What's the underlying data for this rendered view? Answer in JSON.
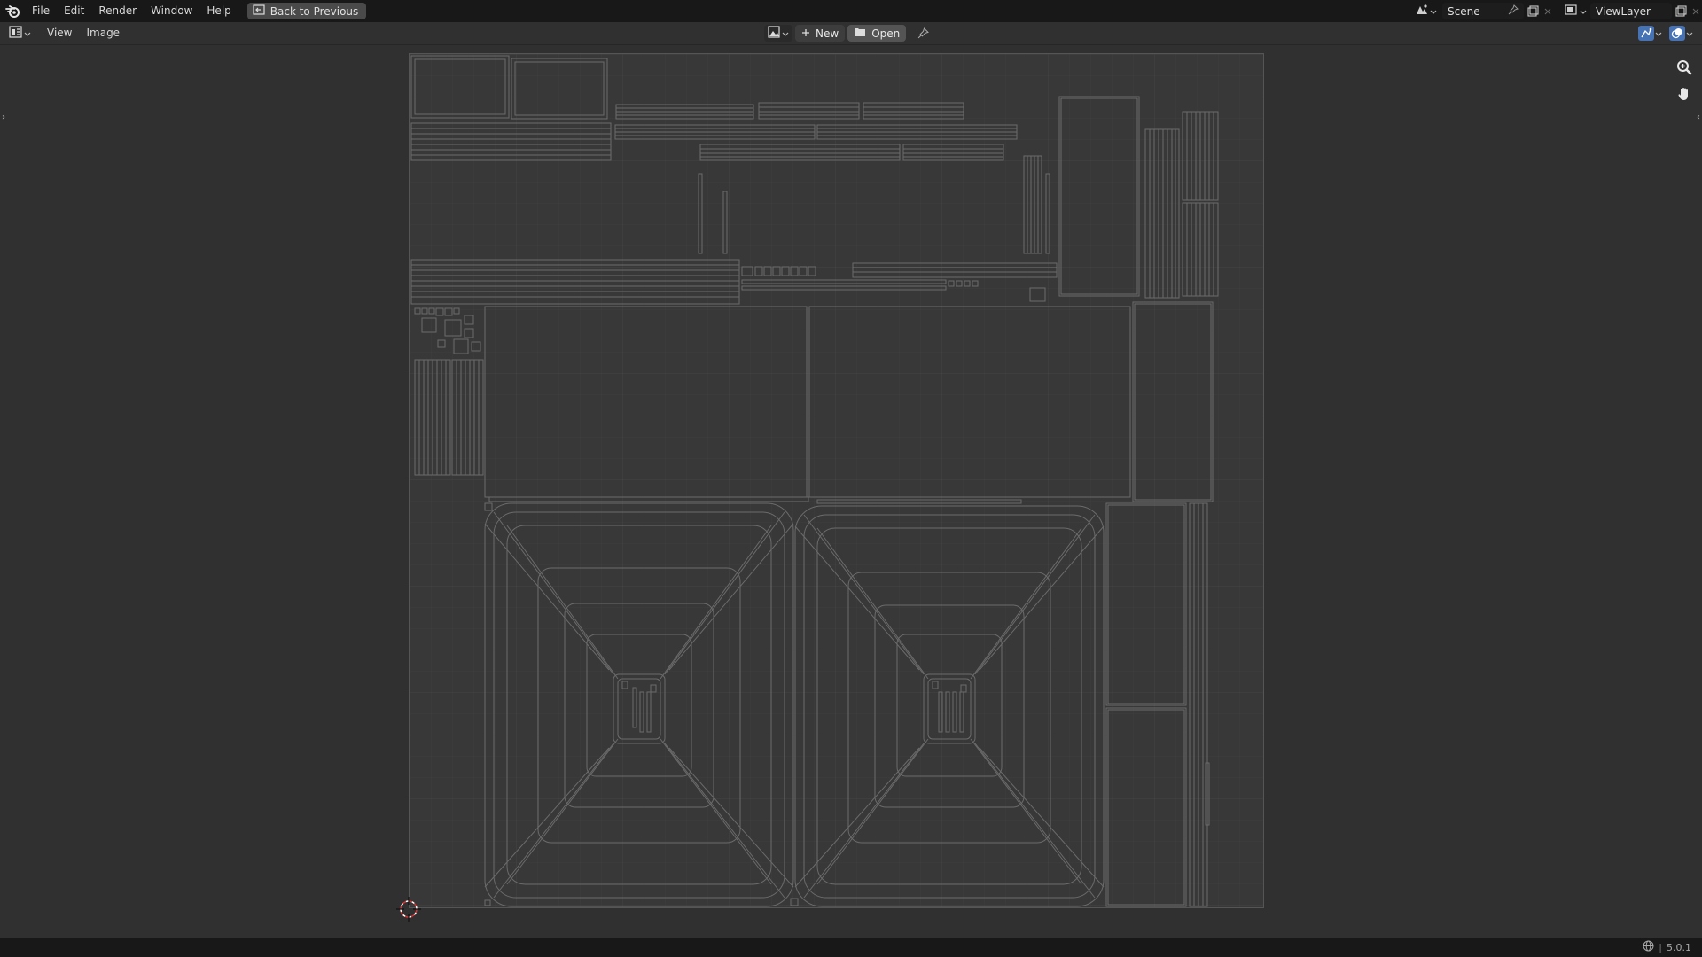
{
  "topbar": {
    "menus": [
      "File",
      "Edit",
      "Render",
      "Window",
      "Help"
    ],
    "back_label": "Back to Previous",
    "scene_name": "Scene",
    "view_layer_name": "ViewLayer"
  },
  "header": {
    "menus": [
      "View",
      "Image"
    ],
    "new_label": "New",
    "open_label": "Open"
  },
  "status": {
    "version": "5.0.1"
  },
  "colors": {
    "accent": "#4772b3",
    "wire": "#6a6a6a"
  },
  "icons": [
    "blender-logo-icon",
    "back-icon",
    "scene-icon",
    "pin-icon",
    "new-scene-icon",
    "close-icon",
    "view-layer-icon",
    "editor-type-icon",
    "image-browse-icon",
    "plus-icon",
    "folder-icon",
    "uv-sync-icon",
    "overlay-icon",
    "zoom-icon",
    "hand-icon",
    "cursor-3d-icon",
    "globe-icon"
  ]
}
